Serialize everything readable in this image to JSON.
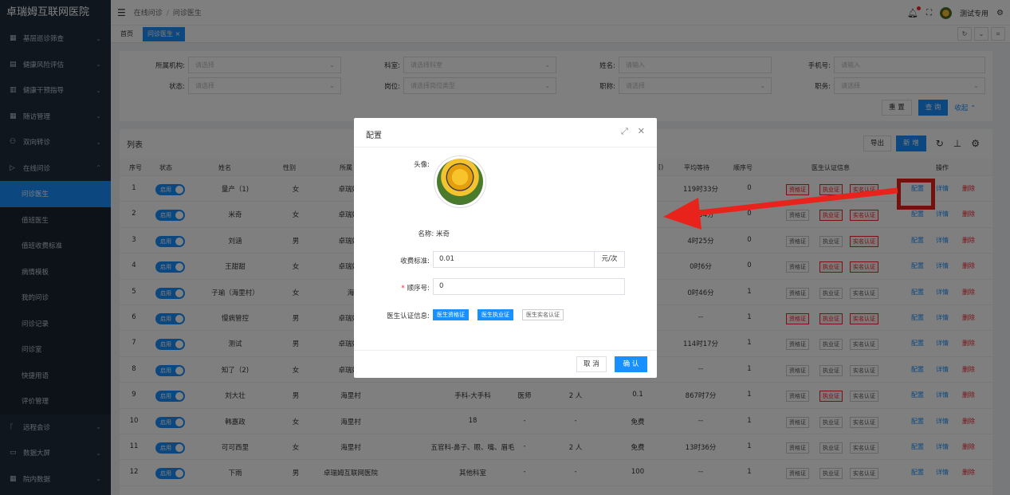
{
  "app": {
    "title": "卓瑞姆互联网医院"
  },
  "sidebar": {
    "items": [
      {
        "label": "基层巡诊筛查",
        "icon": "grid-icon"
      },
      {
        "label": "健康风险评估",
        "icon": "doc-icon"
      },
      {
        "label": "健康干预指导",
        "icon": "list-icon"
      },
      {
        "label": "随访管理",
        "icon": "table-icon"
      },
      {
        "label": "双向转诊",
        "icon": "people-icon"
      },
      {
        "label": "在线问诊",
        "icon": "send-icon"
      }
    ],
    "sub_items": [
      "问诊医生",
      "值班医生",
      "值班收费标准",
      "病情模板",
      "我的问诊",
      "问诊记录",
      "问诊室",
      "快捷用语",
      "评价管理"
    ],
    "bottom_items": [
      {
        "label": "远程会诊",
        "icon": "branch-icon"
      },
      {
        "label": "数据大屏",
        "icon": "screen-icon"
      },
      {
        "label": "院内数据",
        "icon": "grid-icon"
      }
    ]
  },
  "header": {
    "breadcrumb": [
      "在线问诊",
      "问诊医生"
    ],
    "user": "测试专用"
  },
  "tabs": {
    "home": "首页",
    "current": "问诊医生"
  },
  "filters": {
    "org_label": "所属机构:",
    "org_placeholder": "请选择",
    "dept_label": "科室:",
    "dept_placeholder": "请选择科室",
    "name_label": "姓名:",
    "name_placeholder": "请输入",
    "phone_label": "手机号:",
    "phone_placeholder": "请输入",
    "status_label": "状态:",
    "status_placeholder": "请选择",
    "post_label": "岗位:",
    "post_placeholder": "请选择岗位类型",
    "title_label": "职称:",
    "title_placeholder": "请选择",
    "duty_label": "职务:",
    "duty_placeholder": "请选择",
    "reset": "重 置",
    "search": "查 询",
    "collapse": "收起"
  },
  "list": {
    "title": "列表",
    "export": "导出",
    "add": "新 增",
    "headers": {
      "no": "序号",
      "status": "状态",
      "name": "姓名",
      "gender": "性别",
      "org": "所属",
      "avg_wait": "平均等待",
      "order": "顺序号",
      "cert": "医生认证信息",
      "ops": "操作",
      "cut": "[)"
    },
    "toggle_label": "启用",
    "cert_labels": [
      "资格证",
      "执业证",
      "实名认证"
    ],
    "op_labels": {
      "config": "配置",
      "detail": "详情",
      "delete": "删除"
    },
    "rows": [
      {
        "no": "1",
        "name": "量产（1)",
        "gender": "女",
        "org": "卓瑞姆3",
        "dept": "",
        "title": "",
        "count": "",
        "fee": "",
        "wait": "119时33分",
        "order": "0",
        "certred": [
          true,
          true,
          true
        ]
      },
      {
        "no": "2",
        "name": "米奇",
        "gender": "女",
        "org": "卓瑞姆3",
        "dept": "",
        "title": "",
        "count": "",
        "fee": "",
        "wait": "0时34分",
        "order": "0",
        "certred": [
          false,
          true,
          true
        ]
      },
      {
        "no": "3",
        "name": "刘涵",
        "gender": "男",
        "org": "卓瑞姆3",
        "dept": "",
        "title": "",
        "count": "",
        "fee": "",
        "wait": "4时25分",
        "order": "0",
        "certred": [
          false,
          false,
          true
        ]
      },
      {
        "no": "4",
        "name": "王甜甜",
        "gender": "女",
        "org": "卓瑞姆3",
        "dept": "",
        "title": "",
        "count": "",
        "fee": "",
        "wait": "0时6分",
        "order": "0",
        "certred": [
          false,
          true,
          true
        ]
      },
      {
        "no": "5",
        "name": "子瑜（海里村）",
        "gender": "女",
        "org": "海",
        "dept": "",
        "title": "",
        "count": "",
        "fee": "",
        "wait": "0时46分",
        "order": "1",
        "certred": [
          false,
          false,
          false
        ]
      },
      {
        "no": "6",
        "name": "慢病管控",
        "gender": "男",
        "org": "卓瑞姆3",
        "dept": "",
        "title": "",
        "count": "",
        "fee": "",
        "wait": "--",
        "order": "1",
        "certred": [
          true,
          true,
          true
        ]
      },
      {
        "no": "7",
        "name": "测试",
        "gender": "男",
        "org": "卓瑞姆3",
        "dept": "",
        "title": "",
        "count": "",
        "fee": "",
        "wait": "114时17分",
        "order": "1",
        "certred": [
          false,
          false,
          false
        ]
      },
      {
        "no": "8",
        "name": "知了（2)",
        "gender": "女",
        "org": "卓瑞姆3",
        "dept": "",
        "title": "",
        "count": "",
        "fee": "",
        "wait": "--",
        "order": "1",
        "certred": [
          false,
          false,
          false
        ]
      },
      {
        "no": "9",
        "name": "刘大壮",
        "gender": "男",
        "org": "海里村",
        "dept": "手科-大手科",
        "title": "医师",
        "count": "2 人",
        "fee": "0.1",
        "wait": "867时7分",
        "order": "1",
        "certred": [
          false,
          true,
          false
        ]
      },
      {
        "no": "10",
        "name": "韩嘉政",
        "gender": "女",
        "org": "海里村",
        "dept": "18",
        "title": "-",
        "count": "-",
        "fee": "免费",
        "wait": "--",
        "order": "1",
        "certred": [
          false,
          false,
          false
        ]
      },
      {
        "no": "11",
        "name": "可可西里",
        "gender": "女",
        "org": "海里村",
        "dept": "五官科-鼻子、眼、嘴、眉毛",
        "title": "-",
        "count": "2 人",
        "fee": "免费",
        "wait": "13时36分",
        "order": "1",
        "certred": [
          false,
          false,
          false
        ]
      },
      {
        "no": "12",
        "name": "下雨",
        "gender": "男",
        "org": "卓瑞姆互联网医院",
        "dept": "其他科室",
        "title": "-",
        "count": "-",
        "fee": "100",
        "wait": "--",
        "order": "1",
        "certred": [
          false,
          false,
          false
        ]
      }
    ]
  },
  "modal": {
    "title": "配置",
    "avatar_label": "头像:",
    "name_text": "名称: 米奇",
    "fee_label": "收费标准:",
    "fee_value": "0.01",
    "fee_unit": "元/次",
    "order_label": "顺序号:",
    "order_value": "0",
    "cert_label": "医生认证信息:",
    "cert_tags": [
      "医生资格证",
      "医生执业证",
      "医生实名认证"
    ],
    "cancel": "取 消",
    "confirm": "确 认"
  },
  "colors": {
    "primary": "#1890ff",
    "danger": "#f5222d",
    "sidebar": "#1f2d3d",
    "annotation": "#e8231b"
  }
}
